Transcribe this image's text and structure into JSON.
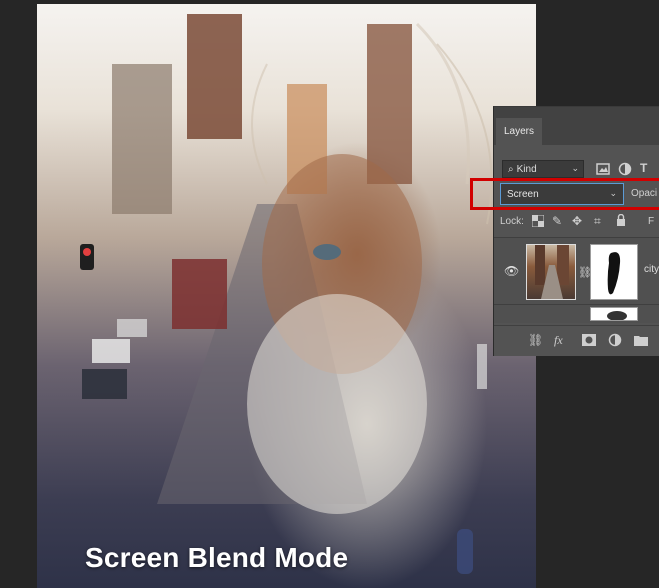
{
  "caption": "Screen Blend Mode",
  "layers_panel": {
    "tab_label": "Layers",
    "kind_filter": {
      "label": "Kind"
    },
    "blend_mode": "Screen",
    "opacity_label": "Opaci",
    "lock_label": "Lock:",
    "fill_label": "F",
    "layer": {
      "name": "city"
    }
  }
}
